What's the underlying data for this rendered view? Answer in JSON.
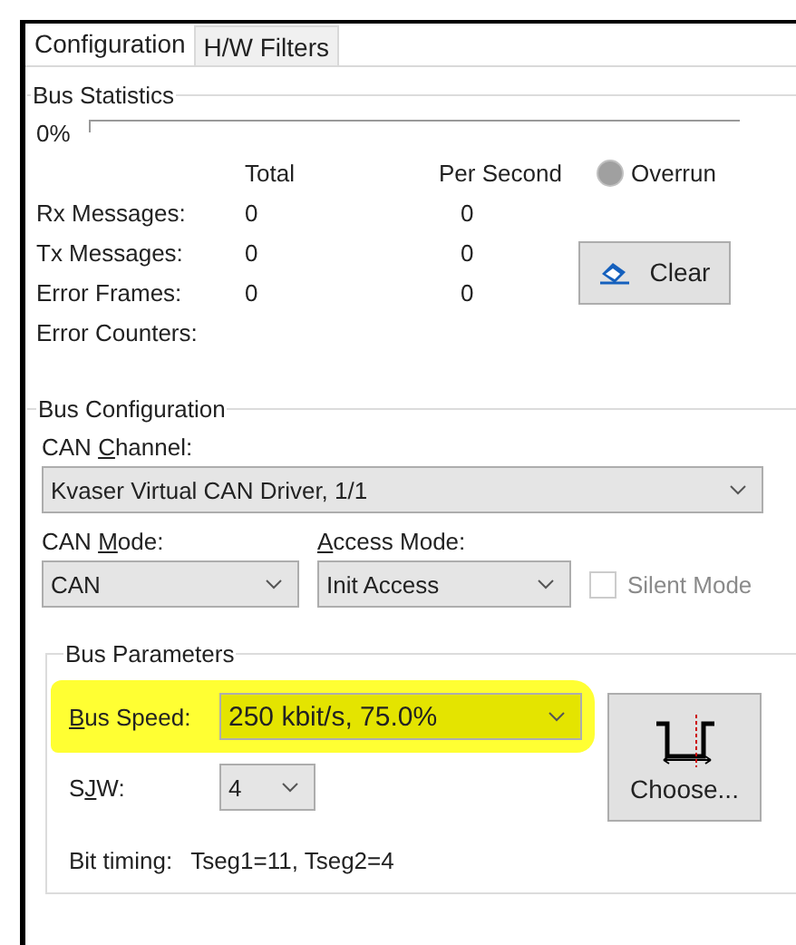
{
  "tabs": [
    {
      "label": "Configuration",
      "selected": true
    },
    {
      "label": "H/W Filters",
      "selected": false
    }
  ],
  "bus_statistics": {
    "title": "Bus Statistics",
    "load": {
      "reading": "0%",
      "level": 0
    },
    "columns": [
      "Total",
      "Per Second"
    ],
    "overrun": {
      "label": "Overrun",
      "on": false
    },
    "rows": [
      {
        "label": "Rx Messages:",
        "total": "0",
        "per_second": "0"
      },
      {
        "label": "Tx Messages:",
        "total": "0",
        "per_second": "0"
      },
      {
        "label": "Error Frames:",
        "total": "0",
        "per_second": "0"
      },
      {
        "label": "Error Counters:"
      }
    ],
    "clear_button": "Clear"
  },
  "bus_configuration": {
    "title": "Bus Configuration",
    "can_channel": {
      "label": {
        "pre": "CAN ",
        "key": "C",
        "post": "hannel:"
      },
      "value": "Kvaser Virtual CAN Driver, 1/1"
    },
    "can_mode": {
      "label": {
        "pre": "CAN ",
        "key": "M",
        "post": "ode:"
      },
      "value": "CAN"
    },
    "access_mode": {
      "label": {
        "key": "A",
        "post": "ccess Mode:"
      },
      "value": "Init Access"
    },
    "silent_mode": {
      "label": "Silent Mode",
      "checked": false,
      "disabled": true
    },
    "bus_parameters": {
      "title": "Bus Parameters",
      "bus_speed": {
        "label": {
          "key": "B",
          "post": "us Speed:"
        },
        "value": "250 kbit/s, 75.0%",
        "highlighted": true
      },
      "sjw": {
        "label": {
          "pre": "S",
          "key": "J",
          "post": "W:"
        },
        "value": "4"
      },
      "choose_button": "Choose...",
      "bit_timing": {
        "label": "Bit timing:",
        "value": "Tseg1=11, Tseg2=4"
      }
    }
  }
}
